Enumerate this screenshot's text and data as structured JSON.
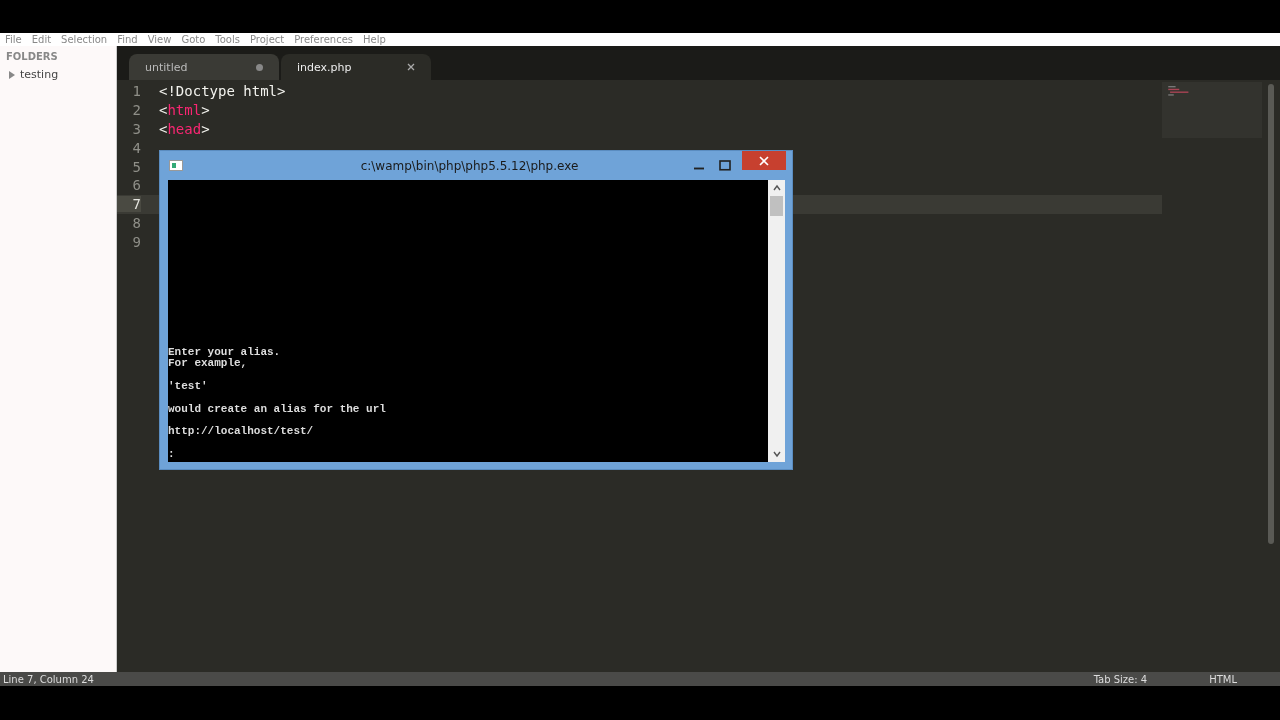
{
  "menu": [
    "File",
    "Edit",
    "Selection",
    "Find",
    "View",
    "Goto",
    "Tools",
    "Project",
    "Preferences",
    "Help"
  ],
  "sidebar": {
    "heading": "FOLDERS",
    "items": [
      {
        "label": "testing",
        "expanded": false
      }
    ]
  },
  "tabs": [
    {
      "label": "untitled",
      "selected": false,
      "modified": true
    },
    {
      "label": "index.php",
      "selected": true,
      "modified": false
    }
  ],
  "editor": {
    "lines": [
      {
        "number": "1",
        "current": false,
        "tokens": [
          {
            "kind": "plain",
            "text": "<!Doctype html>"
          }
        ]
      },
      {
        "number": "2",
        "current": false,
        "tokens": [
          {
            "kind": "plain",
            "text": "<"
          },
          {
            "kind": "tag",
            "text": "html"
          },
          {
            "kind": "plain",
            "text": ">"
          }
        ]
      },
      {
        "number": "3",
        "current": false,
        "tokens": [
          {
            "kind": "plain",
            "text": "<"
          },
          {
            "kind": "tag",
            "text": "head"
          },
          {
            "kind": "plain",
            "text": ">"
          }
        ]
      },
      {
        "number": "4",
        "current": false
      },
      {
        "number": "5",
        "current": false
      },
      {
        "number": "6",
        "current": false
      },
      {
        "number": "7",
        "current": true
      },
      {
        "number": "8",
        "current": false
      },
      {
        "number": "9",
        "current": false
      }
    ]
  },
  "console": {
    "title": "c:\\wamp\\bin\\php\\php5.5.12\\php.exe",
    "paragraphs": [
      [
        "Enter your alias.",
        "For example,"
      ],
      [
        "'test'"
      ],
      [
        "would create an alias for the url"
      ],
      [
        "http://localhost/test/"
      ],
      [
        ":"
      ]
    ]
  },
  "status_bar": {
    "position": "Line 7, Column 24",
    "tab_size": "Tab Size: 4",
    "syntax": "HTML"
  }
}
